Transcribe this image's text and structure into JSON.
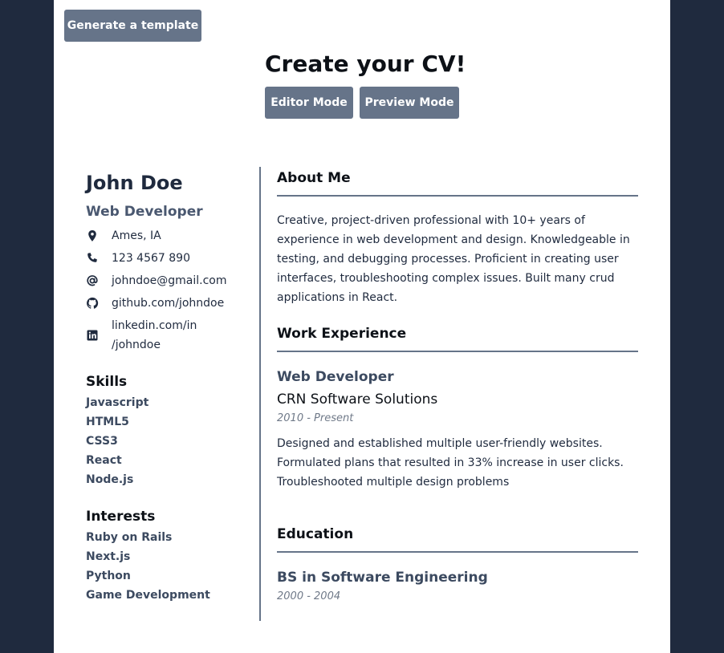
{
  "toolbar": {
    "generate_label": "Generate a template",
    "title": "Create your CV!",
    "editor_label": "Editor Mode",
    "preview_label": "Preview Mode"
  },
  "profile": {
    "name": "John Doe",
    "role": "Web Developer",
    "contacts": [
      {
        "icon": "location-pin-icon",
        "text": "Ames, IA"
      },
      {
        "icon": "phone-icon",
        "text": "123 4567 890"
      },
      {
        "icon": "at-sign-icon",
        "text": "johndoe@gmail.com"
      },
      {
        "icon": "github-icon",
        "text": "github.com/johndoe"
      },
      {
        "icon": "linkedin-icon",
        "text": "linkedin.com/in\n/johndoe"
      }
    ]
  },
  "skills": {
    "heading": "Skills",
    "items": [
      "Javascript",
      "HTML5",
      "CSS3",
      "React",
      "Node.js"
    ]
  },
  "interests": {
    "heading": "Interests",
    "items": [
      "Ruby on Rails",
      "Next.js",
      "Python",
      "Game Development"
    ]
  },
  "about": {
    "heading": "About Me",
    "text": "Creative, project-driven professional with 10+ years of experience in web development and design. Knowledgeable in testing, and debugging processes. Proficient in creating user interfaces, troubleshooting complex issues. Built many crud applications in React."
  },
  "work": {
    "heading": "Work Experience",
    "jobs": [
      {
        "title": "Web Developer",
        "company": "CRN Software Solutions",
        "dates": "2010 - Present",
        "description": "Designed and established multiple user-friendly websites. Formulated plans that resulted in 33% increase in user clicks. Troubleshooted multiple design problems"
      }
    ]
  },
  "education": {
    "heading": "Education",
    "degrees": [
      {
        "title": "BS in Software Engineering",
        "dates": "2000 - 2004"
      }
    ]
  },
  "colors": {
    "background": "#1f2a3e",
    "button": "#667489",
    "accent_text": "#3c4a60"
  }
}
